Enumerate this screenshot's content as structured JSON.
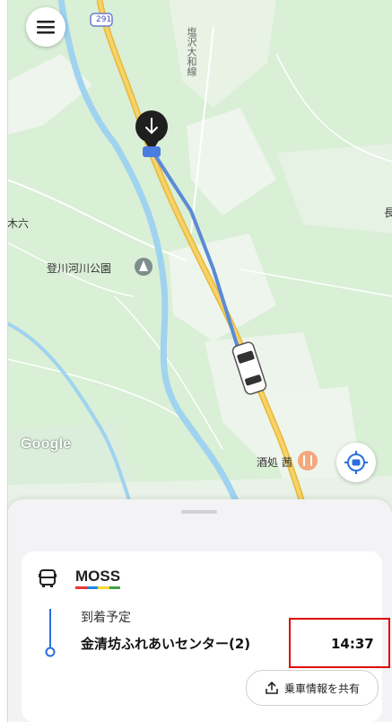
{
  "map": {
    "road_shield": "291",
    "road_shield_small": "291",
    "vertical_road_name": "塩沢大和線",
    "labels": {
      "kiroku": "木六",
      "park": "登川河川公園",
      "sake": "酒処 茜",
      "edge": "長"
    },
    "google_logo": "Google",
    "colors": {
      "route": "#5b8ad8",
      "highway": "#f4c64a",
      "river": "#9fd3f0",
      "land": "#d9efd6"
    }
  },
  "menu_icon": "hamburger-menu-icon",
  "locate_icon": "vehicle-locate-icon",
  "sheet": {
    "brand": "MOSS",
    "brand_colors": [
      "#e53935",
      "#1e88e5",
      "#fdd835",
      "#43a047"
    ],
    "arrival_label": "到着予定",
    "destination": "金清坊ふれあいセンター(2)",
    "arrival_time": "14:37",
    "share_label": "乗車情報を共有"
  }
}
